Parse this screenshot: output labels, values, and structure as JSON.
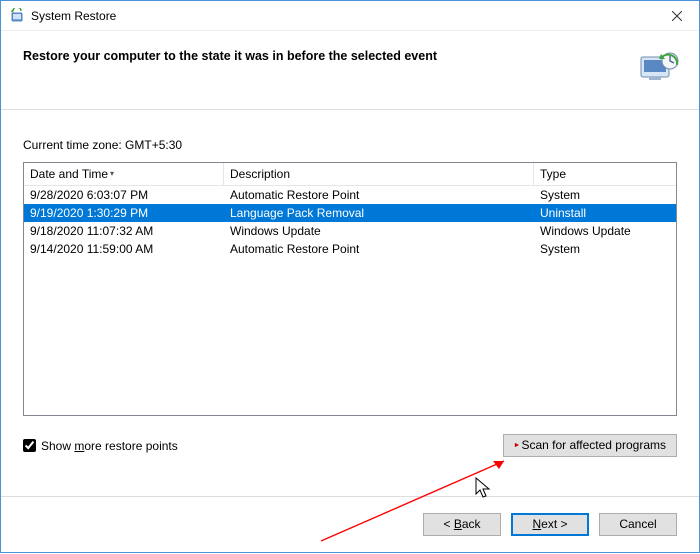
{
  "titlebar": {
    "title": "System Restore"
  },
  "header": {
    "headline": "Restore your computer to the state it was in before the selected event"
  },
  "body": {
    "timezone_label": "Current time zone: GMT+5:30",
    "columns": {
      "date": "Date and Time",
      "desc": "Description",
      "type": "Type"
    },
    "rows": [
      {
        "date": "9/28/2020 6:03:07 PM",
        "desc": "Automatic Restore Point",
        "type": "System",
        "selected": false
      },
      {
        "date": "9/19/2020 1:30:29 PM",
        "desc": "Language Pack Removal",
        "type": "Uninstall",
        "selected": true
      },
      {
        "date": "9/18/2020 11:07:32 AM",
        "desc": "Windows Update",
        "type": "Windows Update",
        "selected": false
      },
      {
        "date": "9/14/2020 11:59:00 AM",
        "desc": "Automatic Restore Point",
        "type": "System",
        "selected": false
      }
    ],
    "show_more_prefix": "Show ",
    "show_more_u": "m",
    "show_more_suffix": "ore restore points",
    "show_more_checked": true,
    "scan_label": "Scan for affected programs"
  },
  "footer": {
    "back_prefix": "< ",
    "back_u": "B",
    "back_suffix": "ack",
    "next_u": "N",
    "next_suffix": "ext >",
    "cancel": "Cancel"
  }
}
